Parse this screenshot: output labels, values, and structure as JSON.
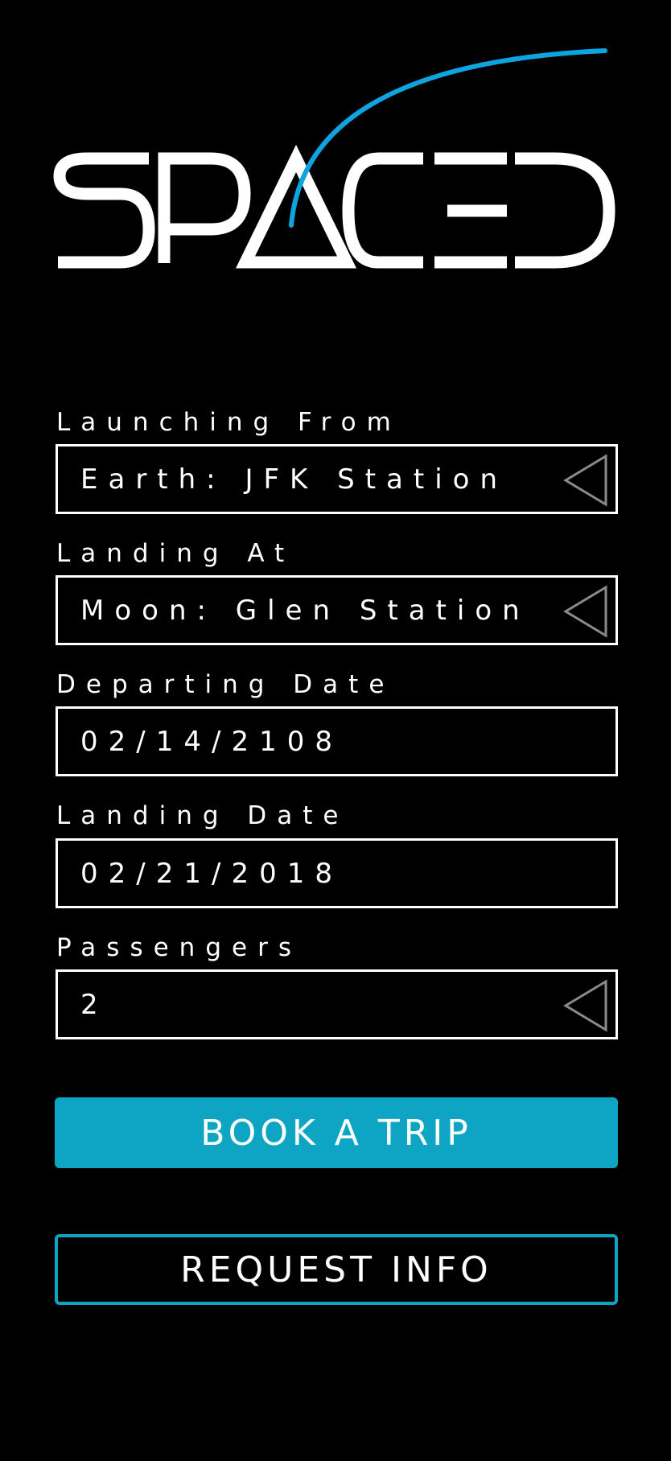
{
  "brand": {
    "logo_text": "SPACED",
    "logo_color": "#ffffff",
    "orbit_color": "#0ea4e0"
  },
  "form": {
    "launching_from": {
      "label": "Launching From",
      "value": "Earth: JFK Station",
      "icon": "caret-left-icon"
    },
    "landing_at": {
      "label": "Landing At",
      "value": "Moon: Glen Station",
      "icon": "caret-left-icon"
    },
    "departing_date": {
      "label": "Departing Date",
      "value": "02/14/2108"
    },
    "landing_date": {
      "label": "Landing Date",
      "value": "02/21/2018"
    },
    "passengers": {
      "label": "Passengers",
      "value": "2",
      "icon": "caret-left-icon"
    }
  },
  "actions": {
    "book_label": "BOOK A TRIP",
    "info_label": "REQUEST INFO",
    "accent_color": "#0ea4c4"
  }
}
